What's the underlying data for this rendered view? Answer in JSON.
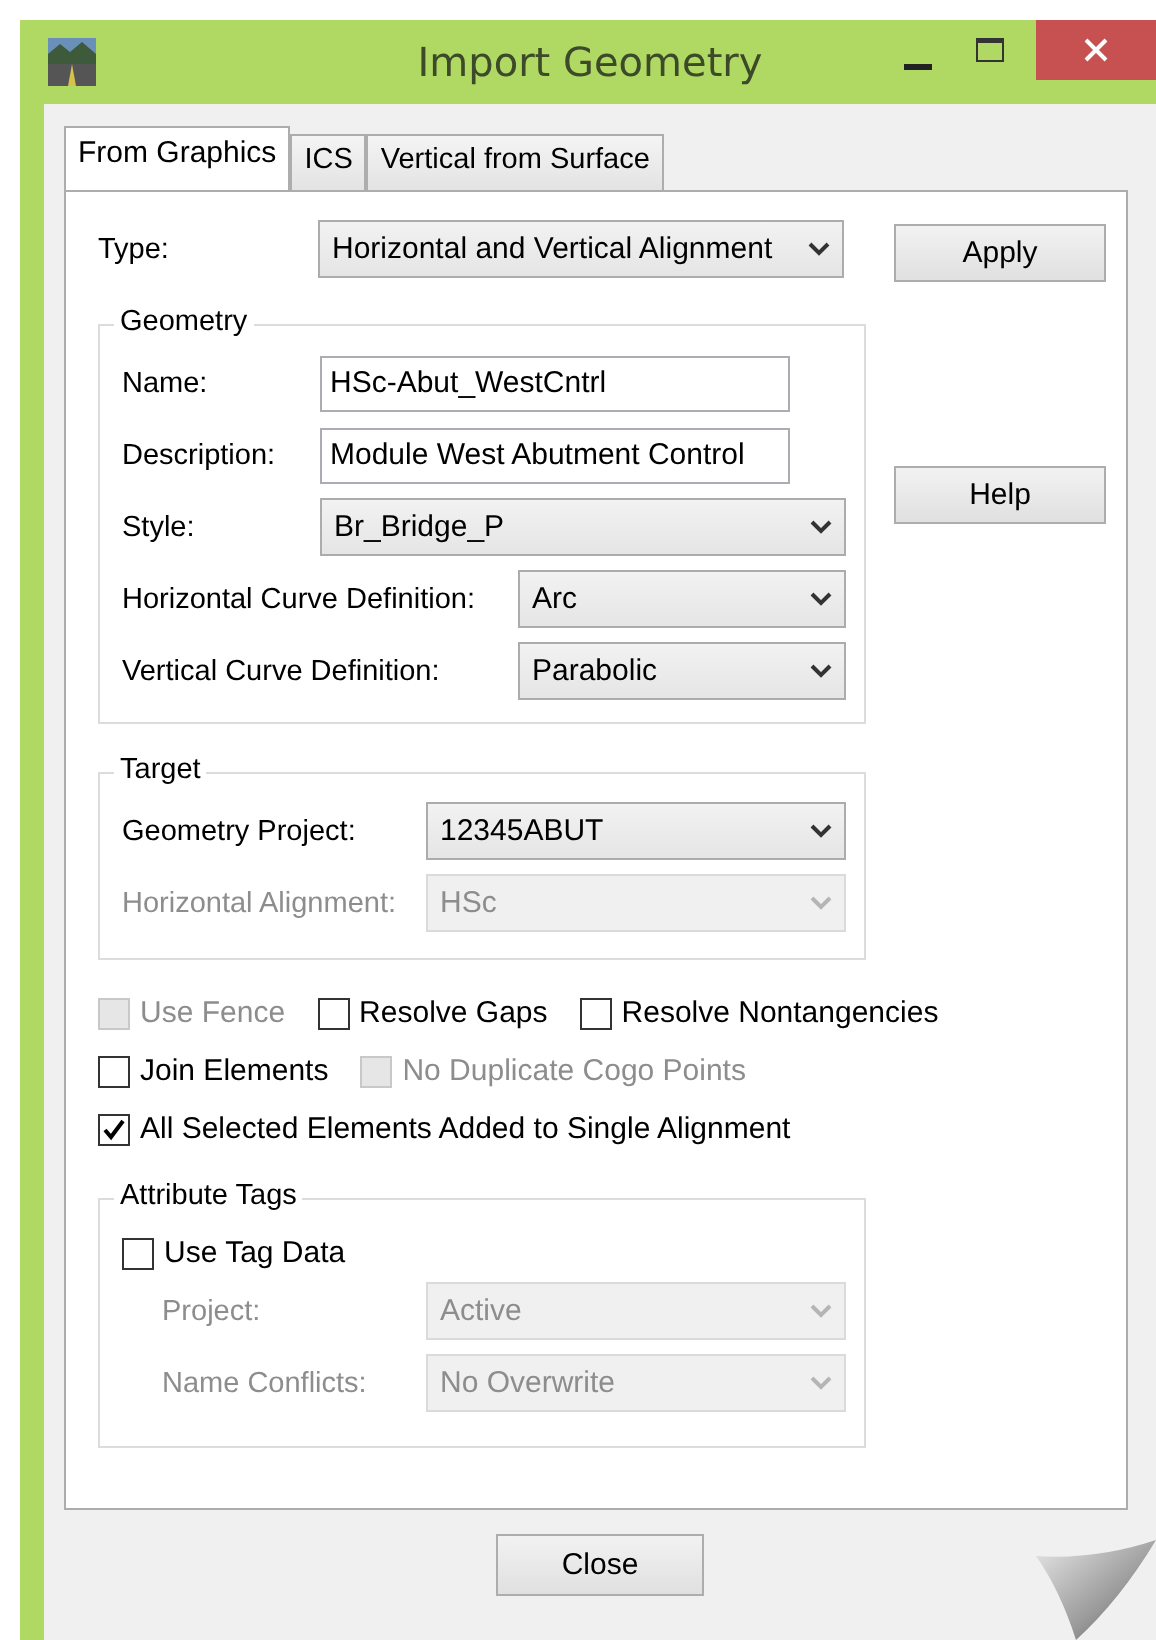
{
  "window": {
    "title": "Import Geometry"
  },
  "tabs": [
    {
      "label": "From Graphics",
      "selected": true
    },
    {
      "label": "ICS",
      "selected": false
    },
    {
      "label": "Vertical from Surface",
      "selected": false
    }
  ],
  "type": {
    "label": "Type:",
    "value": "Horizontal and Vertical Alignment"
  },
  "buttons": {
    "apply": "Apply",
    "help": "Help",
    "close": "Close"
  },
  "geometry": {
    "title": "Geometry",
    "fields": [
      {
        "kind": "text",
        "label": "Name:",
        "value": "HSc-Abut_WestCntrl"
      },
      {
        "kind": "text",
        "label": "Description:",
        "value": "Module West Abutment Control"
      },
      {
        "kind": "select",
        "label": "Style:",
        "value": "Br_Bridge_P",
        "disabled": false
      },
      {
        "kind": "select",
        "label": "Horizontal Curve Definition:",
        "value": "Arc",
        "disabled": false
      },
      {
        "kind": "select",
        "label": "Vertical Curve Definition:",
        "value": "Parabolic",
        "disabled": false
      }
    ]
  },
  "target": {
    "title": "Target",
    "fields": [
      {
        "kind": "select",
        "label": "Geometry Project:",
        "value": "12345ABUT",
        "disabled": false
      },
      {
        "kind": "select",
        "label": "Horizontal Alignment:",
        "value": "HSc",
        "disabled": true
      }
    ]
  },
  "options": [
    [
      {
        "label": "Use Fence",
        "checked": false,
        "disabled": true
      },
      {
        "label": "Resolve Gaps",
        "checked": false,
        "disabled": false
      },
      {
        "label": "Resolve Nontangencies",
        "checked": false,
        "disabled": false
      }
    ],
    [
      {
        "label": "Join Elements",
        "checked": false,
        "disabled": false
      },
      {
        "label": "No Duplicate Cogo Points",
        "checked": false,
        "disabled": true
      }
    ],
    [
      {
        "label": "All Selected Elements Added to Single Alignment",
        "checked": true,
        "disabled": false
      }
    ]
  ],
  "attribute_tags": {
    "title": "Attribute Tags",
    "use_tag_data": {
      "label": "Use Tag Data",
      "checked": false,
      "disabled": false
    },
    "fields": [
      {
        "kind": "select",
        "label": "Project:",
        "value": "Active",
        "disabled": true
      },
      {
        "kind": "select",
        "label": "Name Conflicts:",
        "value": "No Overwrite",
        "disabled": true
      }
    ]
  }
}
